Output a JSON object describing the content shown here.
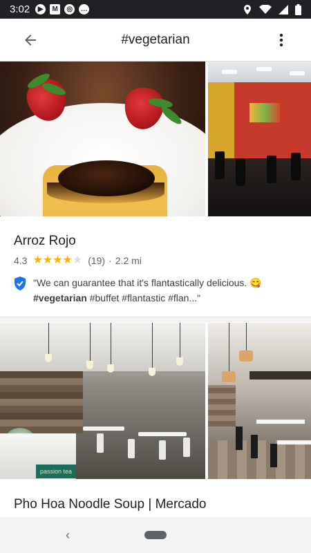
{
  "status_bar": {
    "time": "3:02",
    "left_icons": [
      "media-icon",
      "gmail-icon",
      "maps-icon",
      "chat-icon"
    ],
    "right_icons": [
      "location-icon",
      "wifi-icon",
      "signal-icon",
      "battery-icon"
    ]
  },
  "app_bar": {
    "title": "#vegetarian",
    "back_icon": "arrow-back-icon",
    "more_icon": "more-vertical-icon"
  },
  "listings": [
    {
      "name": "Arroz Rojo",
      "rating": "4.3",
      "rating_value": 4.3,
      "review_count": "(19)",
      "separator": "·",
      "distance": "2.2 mi",
      "review": {
        "quote_start": "\"We can guarantee that it's flantastically delicious. ",
        "emoji": "😋",
        "hashtag_bold": "#vegetarian",
        "hashtags_rest": " #buffet #flantastic #flan...\""
      },
      "photos": [
        "flan-dessert-photo",
        "restaurant-interior-photo"
      ]
    },
    {
      "name": "Pho Hoa Noodle Soup | Mercado",
      "photos": [
        "pho-interior-photo",
        "pho-dining-photo"
      ],
      "sign_text": "passion tea"
    }
  ],
  "colors": {
    "star_full": "#f4b400",
    "star_empty": "#dadce0",
    "shield": "#1a73e8",
    "status_bar_bg": "#202124"
  },
  "nav_bar": {
    "back_label": "‹"
  }
}
